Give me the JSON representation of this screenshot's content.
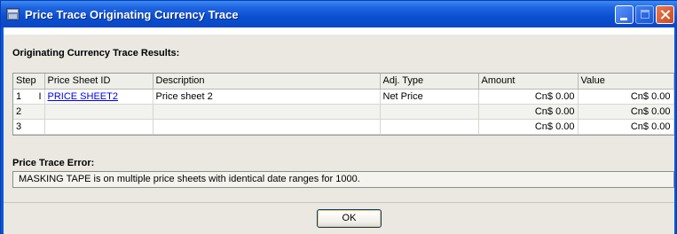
{
  "window": {
    "title": "Price Trace Originating Currency Trace",
    "titlebar_color": "#0a4fd2"
  },
  "results": {
    "heading": "Originating Currency Trace Results:",
    "columns": [
      "Step",
      "Price Sheet ID",
      "Description",
      "Adj. Type",
      "Amount",
      "Value"
    ],
    "rows": [
      {
        "step": "1",
        "marker": "I",
        "sheet_id": "PRICE SHEET2",
        "description": "Price sheet 2",
        "adj_type": "Net Price",
        "amount": "Cn$ 0.00",
        "value": "Cn$ 0.00"
      },
      {
        "step": "2",
        "marker": "",
        "sheet_id": "",
        "description": "",
        "adj_type": "",
        "amount": "Cn$ 0.00",
        "value": "Cn$ 0.00"
      },
      {
        "step": "3",
        "marker": "",
        "sheet_id": "",
        "description": "",
        "adj_type": "",
        "amount": "Cn$ 0.00",
        "value": "Cn$ 0.00"
      }
    ]
  },
  "error": {
    "heading": "Price Trace Error:",
    "message": "MASKING TAPE is on multiple price sheets with identical date ranges for 1000."
  },
  "buttons": {
    "ok_label": "OK"
  },
  "colors": {
    "link": "#0000ee",
    "client_bg": "#eae8e0"
  }
}
